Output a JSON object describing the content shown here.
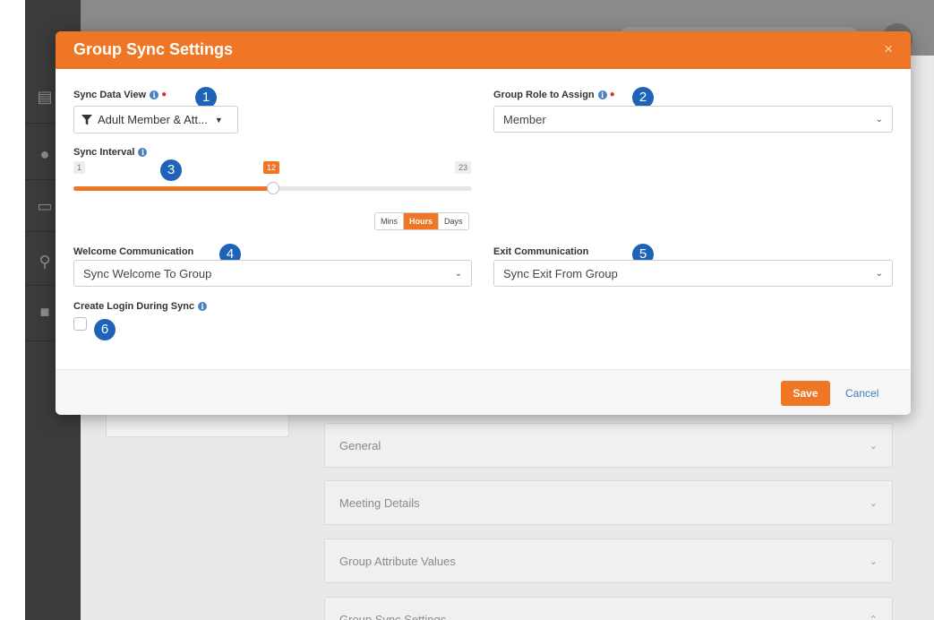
{
  "modal": {
    "title": "Group Sync Settings",
    "close_glyph": "×",
    "sync_data_view": {
      "label": "Sync Data View",
      "required": true,
      "value": "Adult Member & Att...",
      "badge": "1"
    },
    "group_role": {
      "label": "Group Role to Assign",
      "required": true,
      "value": "Member",
      "badge": "2"
    },
    "sync_interval": {
      "label": "Sync Interval",
      "min": "1",
      "max": "23",
      "current": "12",
      "fraction": 0.5,
      "badge": "3",
      "units": [
        "Mins",
        "Hours",
        "Days"
      ],
      "selected_unit": "Hours"
    },
    "welcome_communication": {
      "label": "Welcome Communication",
      "value": "Sync Welcome To Group",
      "badge": "4"
    },
    "exit_communication": {
      "label": "Exit Communication",
      "value": "Sync Exit From Group",
      "badge": "5"
    },
    "create_login": {
      "label": "Create Login During Sync",
      "checked": false,
      "badge": "6"
    },
    "footer": {
      "save_label": "Save",
      "cancel_label": "Cancel"
    }
  },
  "background": {
    "panels": [
      "General",
      "Meeting Details",
      "Group Attribute Values",
      "Group Sync Settings"
    ]
  },
  "colors": {
    "accent": "#ee7624",
    "badge": "#1e63b8",
    "link": "#3b78c4",
    "required": "#d9302c"
  }
}
